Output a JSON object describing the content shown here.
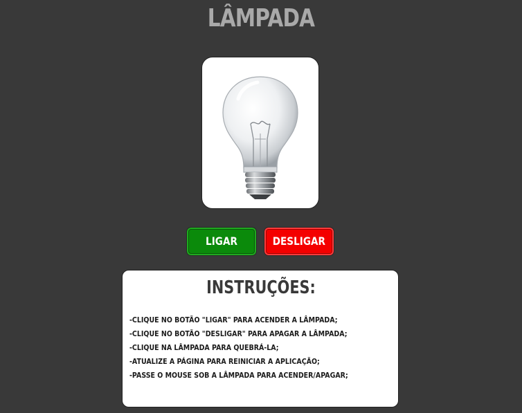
{
  "header": {
    "title": "LÂMPADA"
  },
  "lamp": {
    "state": "off",
    "image": "light-bulb-icon"
  },
  "buttons": {
    "on_label": "LIGAR",
    "off_label": "DESLIGAR"
  },
  "instructions": {
    "title": "INSTRUÇÕES:",
    "items": [
      "-CLIQUE NO BOTÃO \"LIGAR\" PARA ACENDER A LÂMPADA;",
      "-CLIQUE NO BOTÃO \"DESLIGAR\" PARA APAGAR A LÂMPADA;",
      "-CLIQUE NA LÂMPADA PARA QUEBRÁ-LA;",
      "-ATUALIZE A PÁGINA PARA REINICIAR A APLICAÇÃO;",
      "-PASSE O MOUSE SOB A LÂMPADA PARA ACENDER/APAGAR;"
    ]
  },
  "colors": {
    "background": "#393939",
    "on_button": "#0b8a0b",
    "off_button": "#f40000"
  }
}
